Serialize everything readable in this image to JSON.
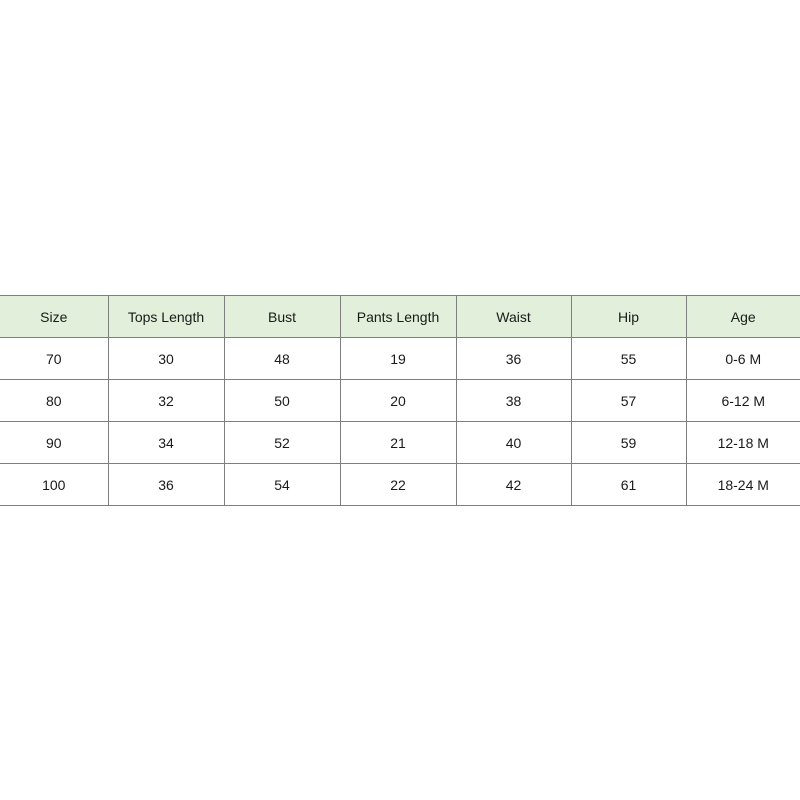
{
  "size_chart": {
    "headers": [
      "Size",
      "Tops Length",
      "Bust",
      "Pants Length",
      "Waist",
      "Hip",
      "Age"
    ],
    "rows": [
      [
        "70",
        "30",
        "48",
        "19",
        "36",
        "55",
        "0-6 M"
      ],
      [
        "80",
        "32",
        "50",
        "20",
        "38",
        "57",
        "6-12 M"
      ],
      [
        "90",
        "34",
        "52",
        "21",
        "40",
        "59",
        "12-18 M"
      ],
      [
        "100",
        "36",
        "54",
        "22",
        "42",
        "61",
        "18-24 M"
      ]
    ],
    "header_background": "#e2efda",
    "border_color": "#7f7f7f"
  }
}
